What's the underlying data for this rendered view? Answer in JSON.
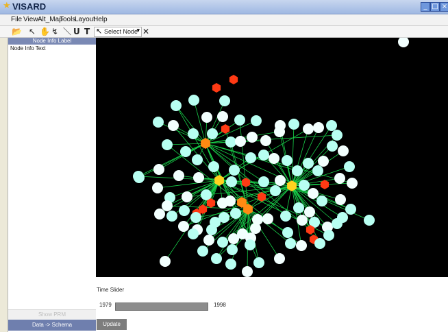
{
  "window": {
    "title": "VISARD"
  },
  "menu": [
    "File",
    "View",
    "Alt_Map",
    "Tools",
    "Layout",
    "Help"
  ],
  "toolbar": {
    "select_label": "Select Node"
  },
  "left_panel": {
    "header": "Node Info Label",
    "text": "Node Info Text",
    "show_prm": "Show PRM",
    "data_schema": "Data -> Schema"
  },
  "time_slider": {
    "label": "Time Slider",
    "start_year": "1979",
    "end_year": "1998",
    "update_label": "Update"
  },
  "colors": {
    "cyan": "#b8fff2",
    "white": "#f2fffe",
    "red": "#ff3a14",
    "orange": "#ff8a12",
    "yellow": "#ffd21f",
    "edge": "#18d14a"
  }
}
